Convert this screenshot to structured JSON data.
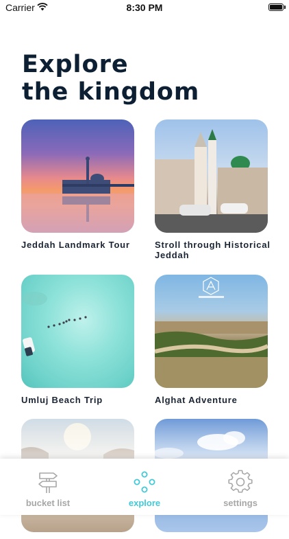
{
  "status_bar": {
    "carrier": "Carrier",
    "time": "8:30 PM"
  },
  "title": {
    "line1": "Explore",
    "line2": "the kingdom"
  },
  "cards": [
    {
      "label": "Jeddah Landmark Tour"
    },
    {
      "label": "Stroll through Historical Jeddah"
    },
    {
      "label": "Umluj Beach Trip"
    },
    {
      "label": "Alghat Adventure"
    },
    {
      "label": ""
    },
    {
      "label": ""
    }
  ],
  "tabs": [
    {
      "label": "bucket list",
      "icon": "signpost-icon",
      "active": false
    },
    {
      "label": "explore",
      "icon": "compass-dots-icon",
      "active": true
    },
    {
      "label": "settings",
      "icon": "gear-icon",
      "active": false
    }
  ],
  "colors": {
    "accent": "#42c9d6",
    "inactive": "#a7a7a7",
    "title": "#0d1f33"
  }
}
